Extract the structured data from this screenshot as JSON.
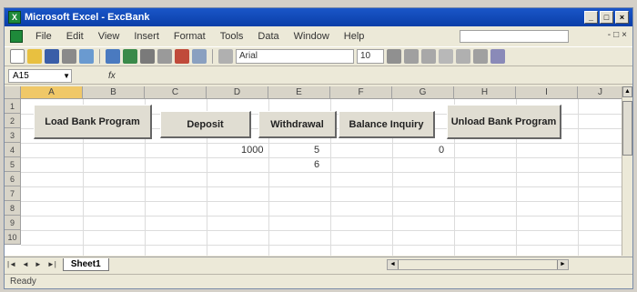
{
  "window": {
    "title": "Microsoft Excel - ExcBank",
    "controls": [
      "_",
      "□",
      "×"
    ]
  },
  "menubar": {
    "items": [
      "File",
      "Edit",
      "View",
      "Insert",
      "Format",
      "Tools",
      "Data",
      "Window",
      "Help"
    ],
    "doc_controls": [
      "-",
      "□",
      "×"
    ]
  },
  "toolbar": {
    "font": "Arial",
    "size": "10"
  },
  "formula_bar": {
    "name_box": "A15",
    "fx": "fx"
  },
  "grid": {
    "columns": [
      "A",
      "B",
      "C",
      "D",
      "E",
      "F",
      "G",
      "H",
      "I",
      "J"
    ],
    "selected_column": "A",
    "rows": [
      "1",
      "2",
      "3",
      "4",
      "5",
      "6",
      "7",
      "8",
      "9",
      "10"
    ],
    "cells": {
      "D4": "1000",
      "E4": "5",
      "E5": "6",
      "G4": "0"
    }
  },
  "buttons": {
    "load": "Load Bank Program",
    "deposit": "Deposit",
    "withdrawal": "Withdrawal",
    "balance": "Balance Inquiry",
    "unload": "Unload Bank Program"
  },
  "sheet_tabs": {
    "nav": [
      "|◄",
      "◄",
      "►",
      "►|"
    ],
    "active": "Sheet1"
  },
  "status": "Ready"
}
